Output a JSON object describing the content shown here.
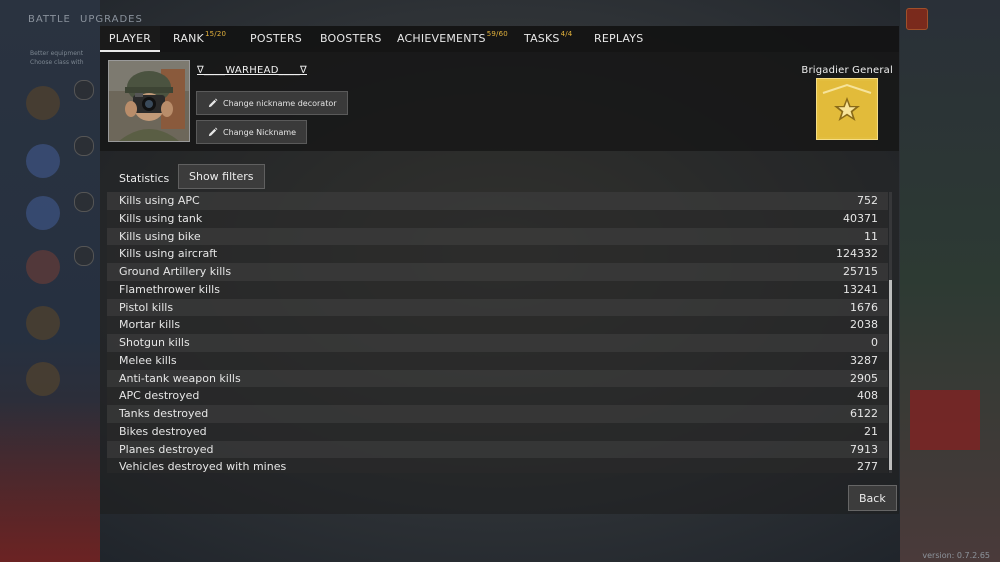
{
  "background": {
    "side_tabs": [
      "BATTLE",
      "UPGRADES"
    ],
    "side_text": [
      "Better equipment",
      "Choose class with"
    ],
    "version": "version: 0.7.2.65"
  },
  "tabs": [
    {
      "label": "PLAYER",
      "sup": "",
      "active": true
    },
    {
      "label": "RANK",
      "sup": "15/20",
      "active": false
    },
    {
      "label": "POSTERS",
      "sup": "",
      "active": false
    },
    {
      "label": "BOOSTERS",
      "sup": "",
      "active": false
    },
    {
      "label": "ACHIEVEMENTS",
      "sup": "59/60",
      "active": false
    },
    {
      "label": "TASKS",
      "sup": "4/4",
      "active": false
    },
    {
      "label": "REPLAYS",
      "sup": "",
      "active": false
    }
  ],
  "player": {
    "nickname": "∇____WARHEAD____∇",
    "change_decorator_label": "Change nickname decorator",
    "change_nickname_label": "Change Nickname",
    "rank_title": "Brigadier General",
    "badge_color": "#e3be3f"
  },
  "statistics": {
    "header": "Statistics",
    "filters_label": "Show filters",
    "rows": [
      {
        "label": "Kills using APC",
        "value": "752"
      },
      {
        "label": "Kills using tank",
        "value": "40371"
      },
      {
        "label": "Kills using bike",
        "value": "11"
      },
      {
        "label": "Kills using aircraft",
        "value": "124332"
      },
      {
        "label": "Ground Artillery kills",
        "value": "25715"
      },
      {
        "label": "Flamethrower kills",
        "value": "13241"
      },
      {
        "label": "Pistol kills",
        "value": "1676"
      },
      {
        "label": "Mortar kills",
        "value": "2038"
      },
      {
        "label": "Shotgun kills",
        "value": "0"
      },
      {
        "label": "Melee kills",
        "value": "3287"
      },
      {
        "label": "Anti-tank weapon kills",
        "value": "2905"
      },
      {
        "label": "APC destroyed",
        "value": "408"
      },
      {
        "label": "Tanks destroyed",
        "value": "6122"
      },
      {
        "label": "Bikes destroyed",
        "value": "21"
      },
      {
        "label": "Planes destroyed",
        "value": "7913"
      },
      {
        "label": "Vehicles destroyed with mines",
        "value": "277"
      }
    ]
  },
  "back_label": "Back"
}
